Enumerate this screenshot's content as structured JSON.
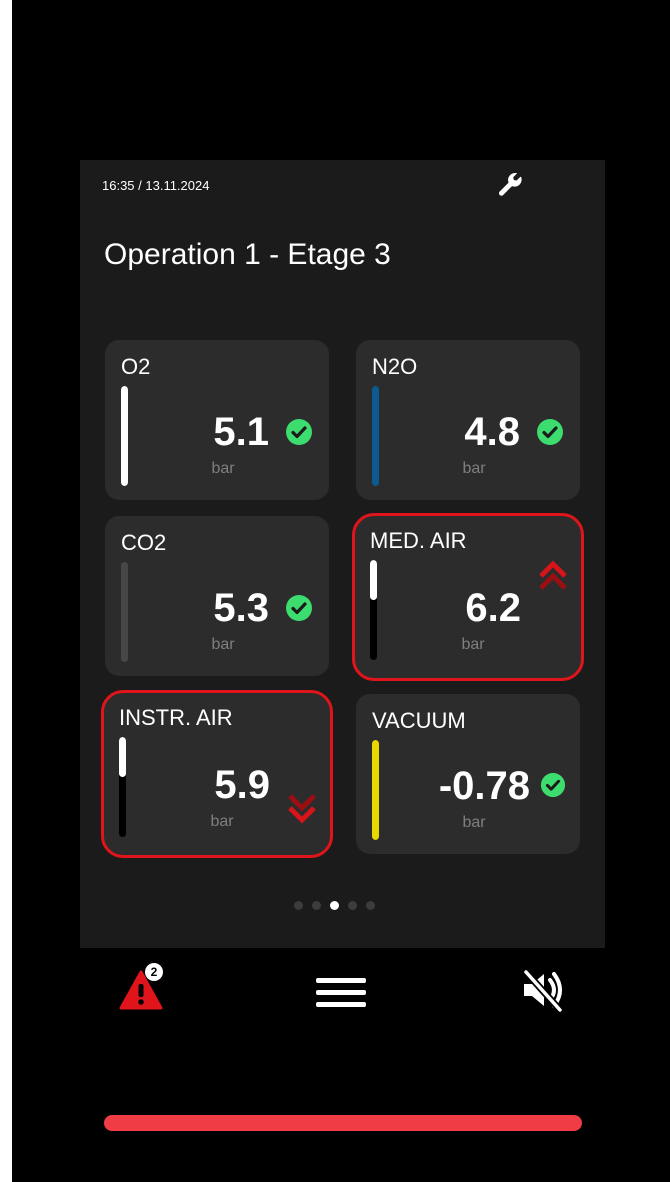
{
  "header": {
    "datetime": "16:35 / 13.11.2024",
    "title": "Operation 1 - Etage 3",
    "settings_icon": "wrench-icon"
  },
  "gases": [
    {
      "name": "O2",
      "value": "5.1",
      "unit": "bar",
      "status": "ok",
      "bar_color": "#ffffff",
      "bar_level": 1.0
    },
    {
      "name": "N2O",
      "value": "4.8",
      "unit": "bar",
      "status": "ok",
      "bar_color": "#0c5a90",
      "bar_level": 1.0
    },
    {
      "name": "CO2",
      "value": "5.3",
      "unit": "bar",
      "status": "ok",
      "bar_color": "#474747",
      "bar_level": 1.0
    },
    {
      "name": "MED. AIR",
      "value": "6.2",
      "unit": "bar",
      "status": "high",
      "bar_color": "#ffffff",
      "bar_level": 0.4
    },
    {
      "name": "INSTR. AIR",
      "value": "5.9",
      "unit": "bar",
      "status": "low",
      "bar_color": "#ffffff",
      "bar_level": 0.4
    },
    {
      "name": "VACUUM",
      "value": "-0.78",
      "unit": "bar",
      "status": "ok",
      "bar_color": "#e8d800",
      "bar_level": 1.0
    }
  ],
  "pagination": {
    "pages": 5,
    "current": 3
  },
  "nav": {
    "alarm_icon": "alarm-triangle-icon",
    "alarm_count": "2",
    "menu_icon": "hamburger-menu-icon",
    "mute_icon": "speaker-muted-icon"
  },
  "colors": {
    "ok": "#3ddc6e",
    "alarm": "#e0151b",
    "bottom_bar": "#f03c45"
  }
}
